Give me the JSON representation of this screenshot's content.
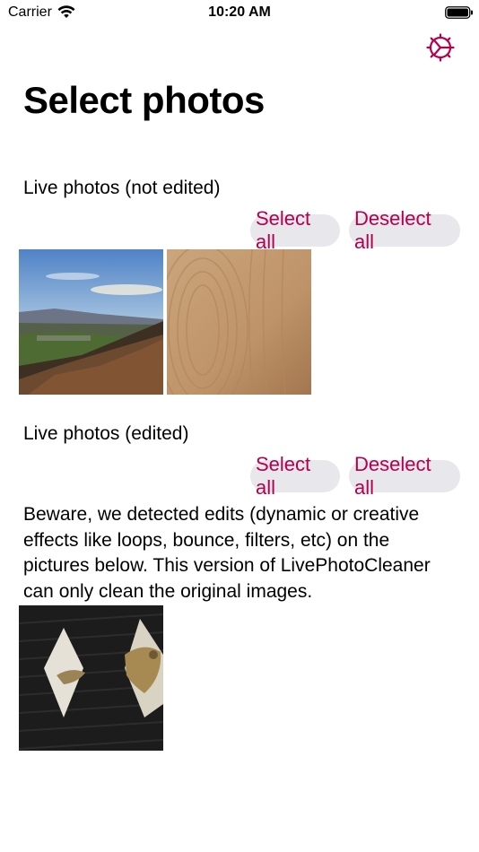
{
  "status_bar": {
    "carrier": "Carrier",
    "time": "10:20 AM"
  },
  "header": {
    "settings_icon": "settings-icon",
    "title": "Select photos"
  },
  "sections": [
    {
      "label": "Live photos (not edited)",
      "select_all": "Select all",
      "deselect_all": "Deselect all",
      "photos": [
        {
          "name": "photo-landscape-valley"
        },
        {
          "name": "photo-wood-grain"
        }
      ]
    },
    {
      "label": "Live photos (edited)",
      "select_all": "Select all",
      "deselect_all": "Deselect all",
      "warning": "Beware, we detected edits (dynamic or creative effects like loops, bounce, filters, etc) on the pictures below. This version of LivePhotoCleaner can only clean the original images.",
      "photos": [
        {
          "name": "photo-knit-argyle"
        }
      ]
    }
  ],
  "colors": {
    "accent": "#b4004e",
    "pill_background": "#e8e7ec"
  }
}
